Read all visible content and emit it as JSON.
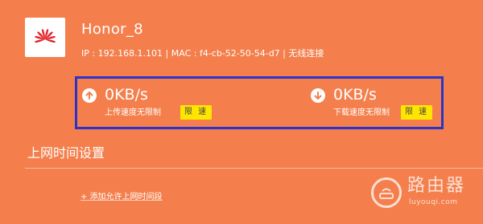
{
  "device": {
    "logo_icon": "huawei-logo-icon",
    "brand_color": "#e3242b",
    "name": "Honor_8",
    "info": "IP : 192.168.1.101 | MAC : f4-cb-52-50-54-d7 | 无线连接"
  },
  "speed": {
    "upload": {
      "icon": "upload-arrow-icon",
      "value": "0KB/s",
      "status": "上传速度无限制",
      "limit_button": "限 速"
    },
    "download": {
      "icon": "download-arrow-icon",
      "value": "0KB/s",
      "status": "下载速度无限制",
      "limit_button": "限 速"
    },
    "highlight_color": "#2b34c9",
    "button_color": "#ffe600"
  },
  "schedule": {
    "title": "上网时间设置",
    "add_link": "+ 添加允许上网时间段"
  },
  "watermark": {
    "title": "路由器",
    "subtitle": "luyouqi.com"
  },
  "colors": {
    "background": "#f47f4c"
  }
}
